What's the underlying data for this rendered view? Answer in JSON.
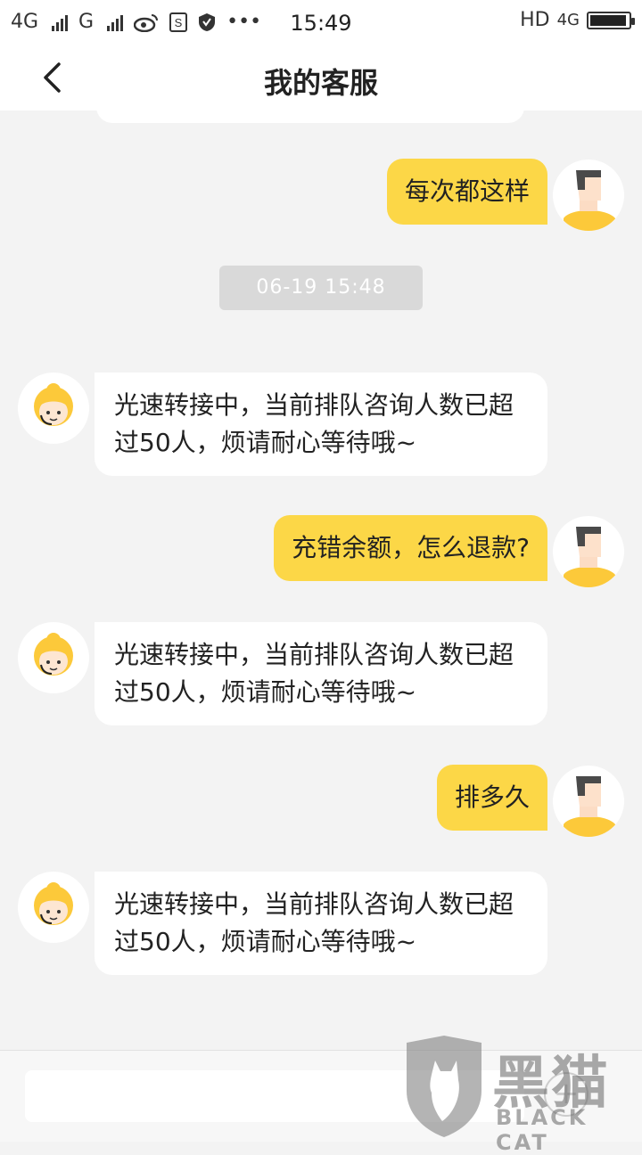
{
  "status_bar": {
    "network_1": "4G",
    "network_2": "G",
    "more": "•••",
    "time": "15:49",
    "hd": "HD",
    "network_3": "4G"
  },
  "header": {
    "title": "我的客服"
  },
  "messages": [
    {
      "role": "user",
      "text": "每次都这样"
    },
    {
      "role": "timestamp",
      "text": "06-19 15:48"
    },
    {
      "role": "agent",
      "text": "光速转接中，当前排队咨询人数已超过50人，烦请耐心等待哦~"
    },
    {
      "role": "user",
      "text": "充错余额，怎么退款?"
    },
    {
      "role": "agent",
      "text": "光速转接中，当前排队咨询人数已超过50人，烦请耐心等待哦~"
    },
    {
      "role": "user",
      "text": "排多久"
    },
    {
      "role": "agent",
      "text": "光速转接中，当前排队咨询人数已超过50人，烦请耐心等待哦~"
    }
  ],
  "input": {
    "value": "",
    "placeholder": ""
  },
  "watermark": {
    "main": "黑猫",
    "sub": "BLACK CAT"
  },
  "colors": {
    "user_bubble": "#fcd747",
    "agent_bubble": "#ffffff",
    "background": "#f3f3f3",
    "timestamp_bg": "#d9d9d9"
  }
}
